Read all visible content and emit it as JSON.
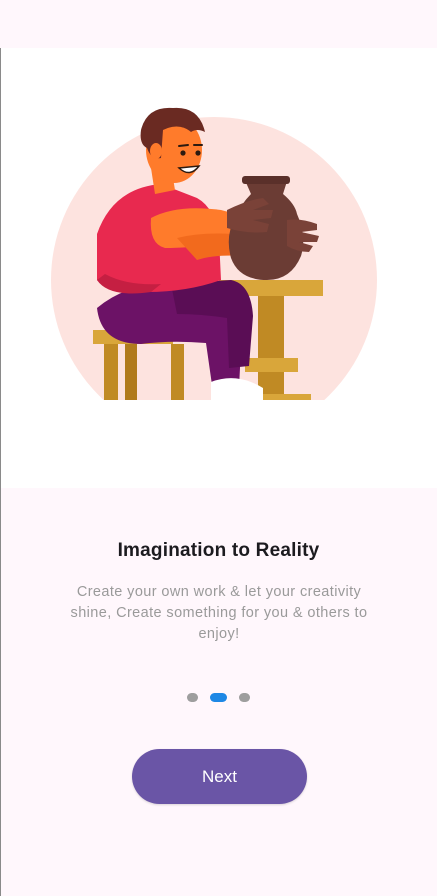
{
  "onboarding": {
    "title": "Imagination to Reality",
    "description": "Create your own work & let your creativity shine, Create something for you & others to enjoy!",
    "pages_total": 3,
    "current_page": 2,
    "next_label": "Next",
    "illustration": "pottery-maker-illustration"
  },
  "colors": {
    "background": "#fff7fc",
    "image_background": "#ffffff",
    "circle": "#fde3df",
    "active_dot": "#1e88e5",
    "inactive_dot": "#9e9e9e",
    "button": "#6a55a6"
  }
}
